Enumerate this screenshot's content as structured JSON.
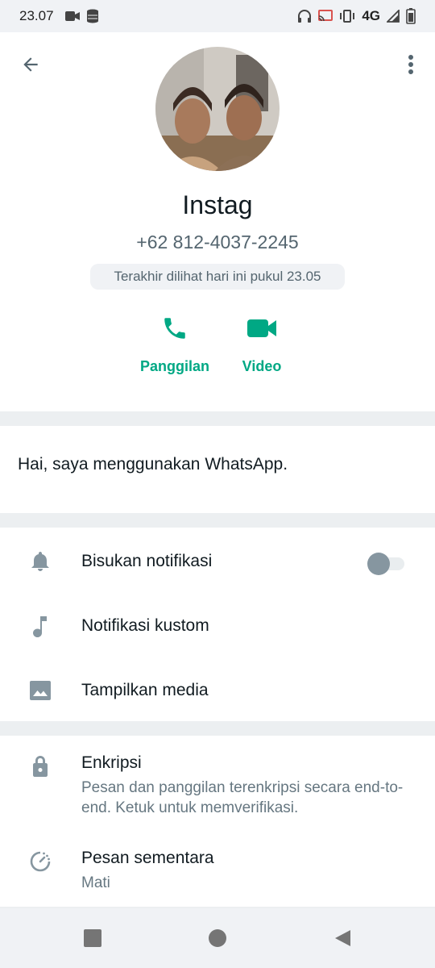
{
  "status_bar": {
    "time": "23.07",
    "network": "4G"
  },
  "contact": {
    "name": "Instag",
    "phone": "+62 812-4037-2245",
    "last_seen": "Terakhir dilihat hari ini pukul 23.05"
  },
  "actions": {
    "call_label": "Panggilan",
    "video_label": "Video"
  },
  "about": {
    "text": "Hai, saya menggunakan WhatsApp."
  },
  "settings": {
    "mute_label": "Bisukan notifikasi",
    "mute_enabled": false,
    "custom_notif_label": "Notifikasi kustom",
    "media_label": "Tampilkan media"
  },
  "security": {
    "encryption_title": "Enkripsi",
    "encryption_sub": "Pesan dan panggilan terenkripsi secara end-to-end. Ketuk untuk memverifikasi.",
    "disappearing_title": "Pesan sementara",
    "disappearing_sub": "Mati"
  },
  "colors": {
    "accent": "#00a884",
    "icon_gray": "#8696a0",
    "text_primary": "#111b21",
    "text_secondary": "#667781"
  },
  "icons": [
    "back-arrow-icon",
    "more-vertical-icon",
    "phone-icon",
    "video-camera-icon",
    "bell-icon",
    "music-note-icon",
    "image-icon",
    "lock-icon",
    "timer-icon",
    "nav-recents-icon",
    "nav-home-icon",
    "nav-back-icon"
  ]
}
